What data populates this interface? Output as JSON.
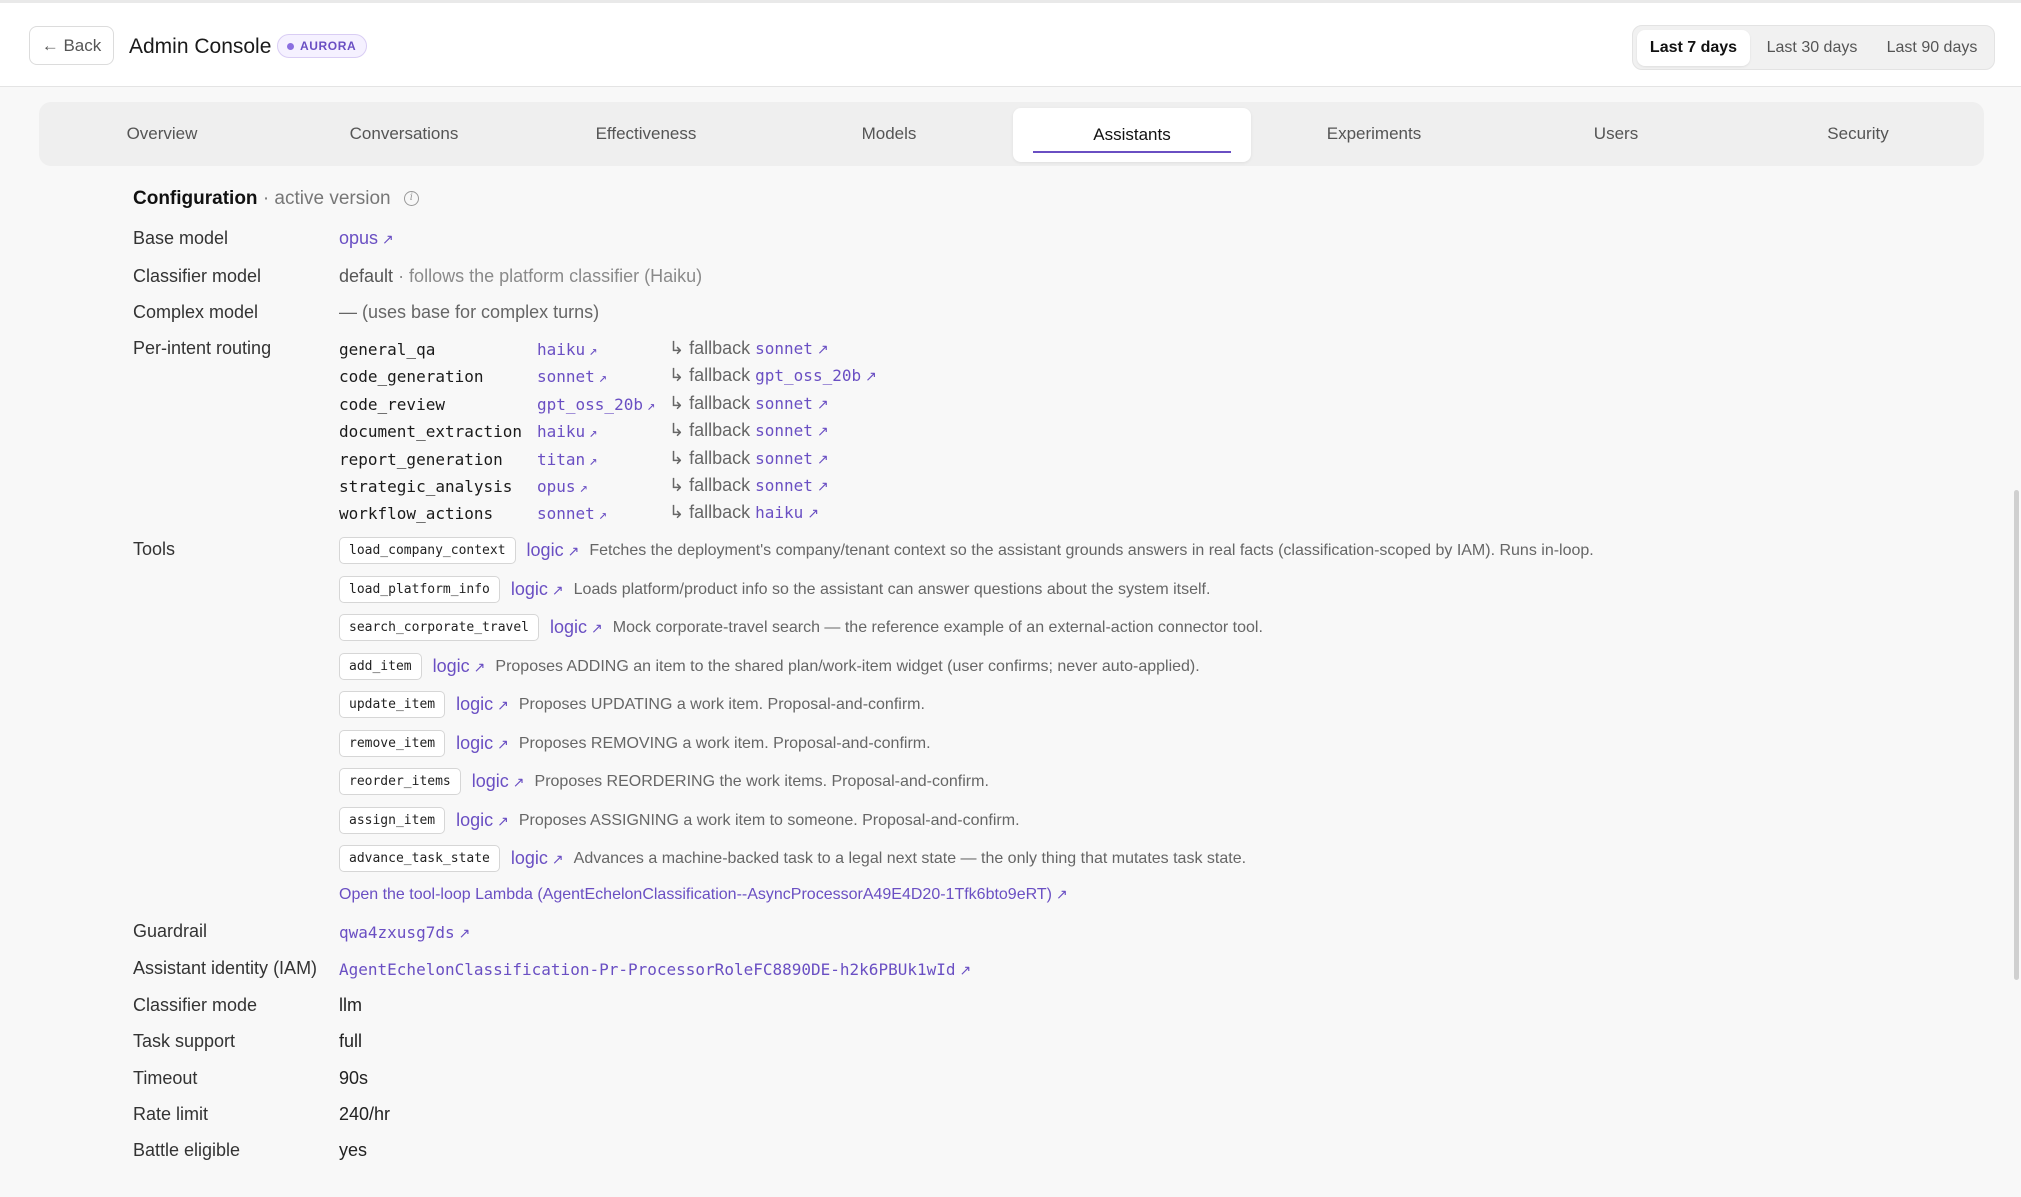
{
  "header": {
    "back_label": "← Back",
    "title": "Admin Console",
    "env_badge": "AURORA",
    "ranges": [
      "Last 7 days",
      "Last 30 days",
      "Last 90 days"
    ],
    "active_range": "Last 7 days"
  },
  "tabs": [
    "Overview",
    "Conversations",
    "Effectiveness",
    "Models",
    "Assistants",
    "Experiments",
    "Users",
    "Security"
  ],
  "active_tab": "Assistants",
  "config": {
    "title": "Configuration",
    "subtitle": "· active version",
    "base_model": {
      "label": "Base model",
      "value": "opus"
    },
    "classifier_model": {
      "label": "Classifier model",
      "value": "default",
      "note": "· follows the platform classifier (Haiku)"
    },
    "complex_model": {
      "label": "Complex model",
      "value": "— (uses base for complex turns)"
    },
    "routing": {
      "label": "Per-intent routing",
      "fallback_prefix": "↳ fallback",
      "rows": [
        {
          "intent": "general_qa",
          "model": "haiku",
          "fallback": "sonnet"
        },
        {
          "intent": "code_generation",
          "model": "sonnet",
          "fallback": "gpt_oss_20b"
        },
        {
          "intent": "code_review",
          "model": "gpt_oss_20b",
          "fallback": "sonnet"
        },
        {
          "intent": "document_extraction",
          "model": "haiku",
          "fallback": "sonnet"
        },
        {
          "intent": "report_generation",
          "model": "titan",
          "fallback": "sonnet"
        },
        {
          "intent": "strategic_analysis",
          "model": "opus",
          "fallback": "sonnet"
        },
        {
          "intent": "workflow_actions",
          "model": "sonnet",
          "fallback": "haiku"
        }
      ]
    },
    "tools": {
      "label": "Tools",
      "logic_label": "logic",
      "items": [
        {
          "name": "load_company_context",
          "desc": "Fetches the deployment's company/tenant context so the assistant grounds answers in real facts (classification-scoped by IAM). Runs in-loop."
        },
        {
          "name": "load_platform_info",
          "desc": "Loads platform/product info so the assistant can answer questions about the system itself."
        },
        {
          "name": "search_corporate_travel",
          "desc": "Mock corporate-travel search — the reference example of an external-action connector tool."
        },
        {
          "name": "add_item",
          "desc": "Proposes ADDING an item to the shared plan/work-item widget (user confirms; never auto-applied)."
        },
        {
          "name": "update_item",
          "desc": "Proposes UPDATING a work item. Proposal-and-confirm."
        },
        {
          "name": "remove_item",
          "desc": "Proposes REMOVING a work item. Proposal-and-confirm."
        },
        {
          "name": "reorder_items",
          "desc": "Proposes REORDERING the work items. Proposal-and-confirm."
        },
        {
          "name": "assign_item",
          "desc": "Proposes ASSIGNING a work item to someone. Proposal-and-confirm."
        },
        {
          "name": "advance_task_state",
          "desc": "Advances a machine-backed task to a legal next state — the only thing that mutates task state."
        }
      ],
      "loop_link": "Open the tool-loop Lambda (AgentEchelonClassification--AsyncProcessorA49E4D20-1Tfk6bto9eRT)"
    },
    "guardrail": {
      "label": "Guardrail",
      "value": "qwa4zxusg7ds"
    },
    "iam": {
      "label": "Assistant identity (IAM)",
      "value": "AgentEchelonClassification-Pr-ProcessorRoleFC8890DE-h2k6PBUk1wId"
    },
    "classifier_mode": {
      "label": "Classifier mode",
      "value": "llm"
    },
    "task_support": {
      "label": "Task support",
      "value": "full"
    },
    "timeout": {
      "label": "Timeout",
      "value": "90s"
    },
    "rate_limit": {
      "label": "Rate limit",
      "value": "240/hr"
    },
    "battle_eligible": {
      "label": "Battle eligible",
      "value": "yes"
    }
  },
  "colors": {
    "accent": "#6a4fc3",
    "background": "#f8f8f8"
  }
}
